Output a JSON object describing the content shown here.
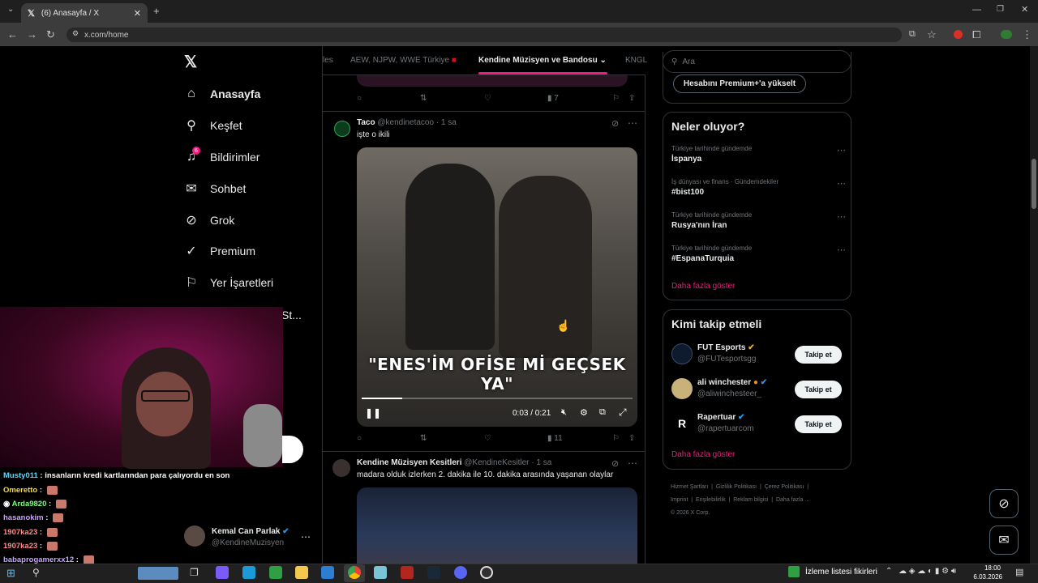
{
  "browser": {
    "tab_title": "(6) Anasayfa / X",
    "url": "x.com/home"
  },
  "sidebar": {
    "items": [
      {
        "label": "Anasayfa",
        "icon": "home-icon"
      },
      {
        "label": "Keşfet",
        "icon": "search-icon"
      },
      {
        "label": "Bildirimler",
        "icon": "bell-icon",
        "badge": "6"
      },
      {
        "label": "Sohbet",
        "icon": "mail-icon"
      },
      {
        "label": "Grok",
        "icon": "grok-icon"
      },
      {
        "label": "Premium",
        "icon": "premium-icon"
      },
      {
        "label": "Yer İşaretleri",
        "icon": "bookmark-icon"
      }
    ],
    "truncated": "St...",
    "account": {
      "name": "Kemal Can Parlak",
      "handle": "@KendineMuzisyen"
    }
  },
  "feed": {
    "tabs": [
      "les",
      "AEW, NJPW, WWE Türkiye",
      "Kendine Müzisyen ve Bandosu",
      "KNGL"
    ],
    "prev_tweet_views": "7",
    "tweet1": {
      "name": "Taco",
      "handle": "@kendinetacoo",
      "time": "· 1 sa",
      "text": "işte o ikili",
      "caption": "\"ENES'İM OFİSE Mİ GEÇSEK YA\"",
      "video_time": "0:03 / 0:21",
      "video_progress": 0.15,
      "views": "11"
    },
    "tweet2": {
      "name": "Kendine Müzisyen Kesitleri",
      "handle": "@KendineKesitler",
      "time": "· 1 sa",
      "text": "madara olduk izlerken 2. dakika ile 10. dakika arasında yaşanan olaylar"
    }
  },
  "right": {
    "search_placeholder": "Ara",
    "premium_button": "Hesabını Premium+'a yükselt",
    "trends_title": "Neler oluyor?",
    "trends": [
      {
        "category": "Türkiye tarihinde gündemde",
        "name": "İspanya"
      },
      {
        "category": "İş dünyası ve finans · Gündemdekiler",
        "name": "#bist100"
      },
      {
        "category": "Türkiye tarihinde gündemde",
        "name": "Rusya'nın İran"
      },
      {
        "category": "Türkiye tarihinde gündemde",
        "name": "#EspanaTurquia"
      }
    ],
    "show_more": "Daha fazla göster",
    "follow_title": "Kimi takip etmeli",
    "follow": [
      {
        "name": "FUT Esports",
        "handle": "@FUTesportsgg"
      },
      {
        "name": "ali winchester",
        "handle": "@aliwinchesteer_"
      },
      {
        "name": "Rapertuar",
        "handle": "@rapertuarcom"
      }
    ],
    "follow_btn": "Takip et",
    "show_more2": "Daha fazla göster",
    "footer": [
      "Hizmet Şartları",
      "Gizlilik Politikası",
      "Çerez Politikası",
      "Imprint",
      "Erişilebilirlik",
      "Reklam bilgisi",
      "Daha fazla ...",
      "© 2026 X Corp."
    ]
  },
  "stream": {
    "chat": [
      {
        "user": "Musty011",
        "msg": "insanların kredi kartlarından para çalıyordu en son"
      },
      {
        "user": "Omeretto",
        "msg": ""
      },
      {
        "user": "Arda9820",
        "msg": ""
      },
      {
        "user": "hasanokim",
        "msg": ""
      },
      {
        "user": "1907ka23",
        "msg": ""
      },
      {
        "user": "1907ka23",
        "msg": ""
      },
      {
        "user": "babaprogamerxx12",
        "msg": ""
      }
    ]
  },
  "taskbar": {
    "notification": "İzleme listesi fikirleri",
    "time": "18:00",
    "date": "6.03.2026"
  }
}
